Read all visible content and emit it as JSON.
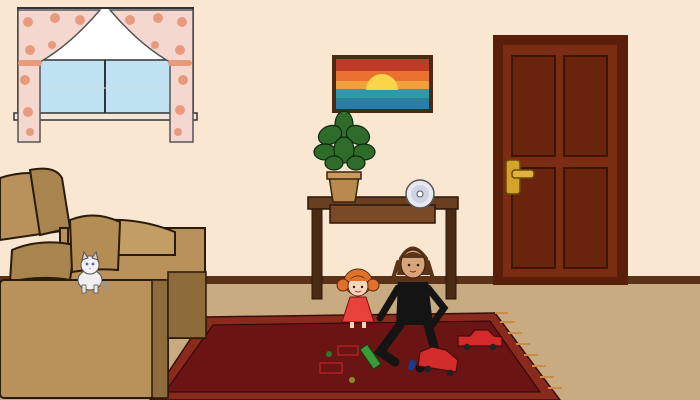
{
  "scene": {
    "name": "living-room",
    "colors": {
      "wall": "#f9e7d2",
      "floor": "#c9ab82",
      "baseboard": "#5a3217",
      "door": "#7a2d12",
      "door_dark": "#5a1f0a",
      "door_handle": "#d4a32a",
      "sofa": "#b8925a",
      "sofa_dark": "#8e6b3a",
      "rug": "#6b1414",
      "rug_border": "#8a2a1c",
      "rug_fringe": "#c98a4a",
      "table": "#6a3f20",
      "table_dark": "#4a2a12",
      "curtain": "#f4d8cf",
      "curtain_flower": "#e79a7e",
      "window_sky": "#bfe3f3",
      "pot": "#b98a4e",
      "leaf": "#2f6b2a"
    },
    "objects": [
      {
        "name": "window",
        "icon": "window-with-curtains"
      },
      {
        "name": "painting",
        "icon": "sunset-painting"
      },
      {
        "name": "plant",
        "icon": "potted-plant"
      },
      {
        "name": "disc",
        "icon": "compact-disc"
      },
      {
        "name": "door",
        "icon": "wooden-door"
      },
      {
        "name": "sofa",
        "icon": "armchair-sofa"
      },
      {
        "name": "cat",
        "icon": "white-cat"
      },
      {
        "name": "doll",
        "icon": "red-haired-doll"
      },
      {
        "name": "child",
        "icon": "girl-in-black"
      },
      {
        "name": "toy-cars",
        "icon": "toy-car"
      }
    ]
  }
}
